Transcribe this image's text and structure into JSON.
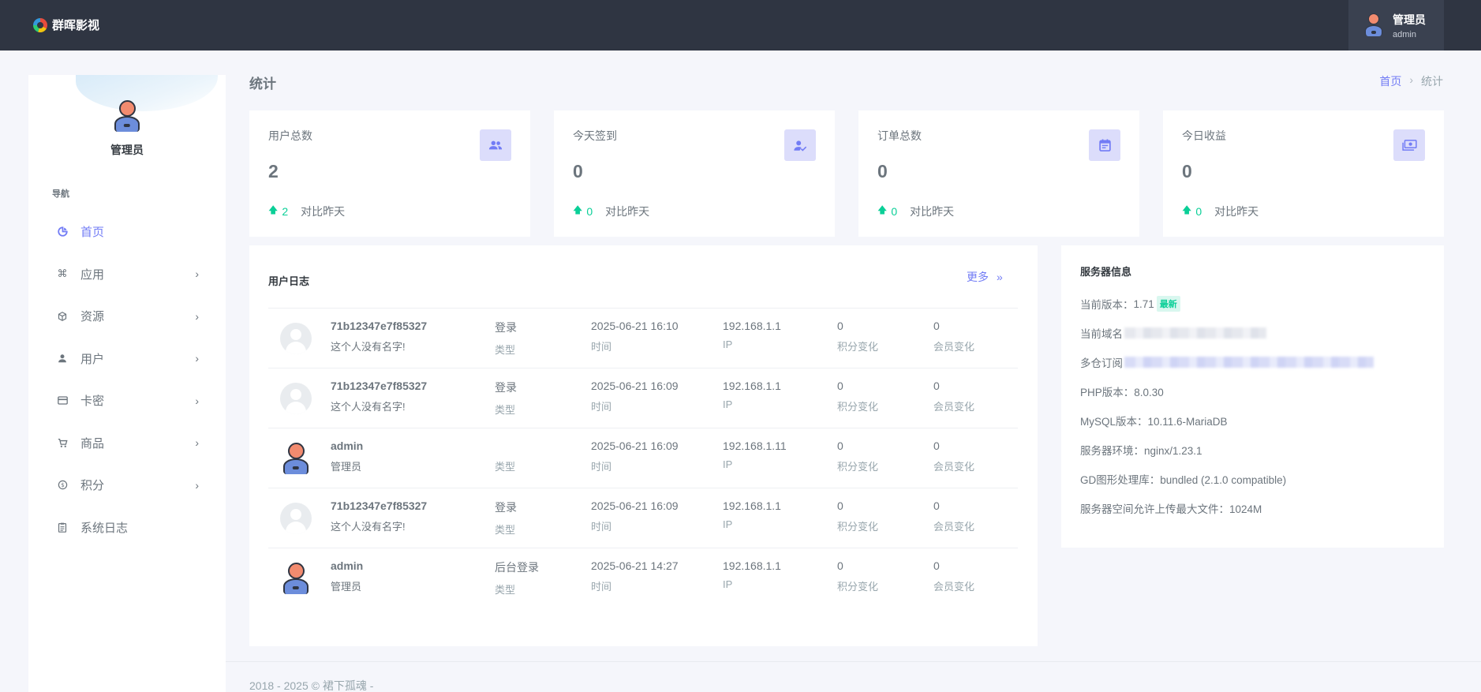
{
  "header": {
    "brand": "群晖影视",
    "user_name": "管理员",
    "user_role": "admin"
  },
  "sidebar": {
    "profile_name": "管理员",
    "nav_label": "导航",
    "items": [
      {
        "label": "首页",
        "icon": "dashboard-icon",
        "active": true
      },
      {
        "label": "应用",
        "icon": "command-icon",
        "has_children": true
      },
      {
        "label": "资源",
        "icon": "cube-icon",
        "has_children": true
      },
      {
        "label": "用户",
        "icon": "user-icon",
        "has_children": true
      },
      {
        "label": "卡密",
        "icon": "card-icon",
        "has_children": true
      },
      {
        "label": "商品",
        "icon": "cart-icon",
        "has_children": true
      },
      {
        "label": "积分",
        "icon": "coin-icon",
        "has_children": true
      },
      {
        "label": "系统日志",
        "icon": "log-icon"
      }
    ]
  },
  "page": {
    "title": "统计",
    "breadcrumb": [
      "首页",
      "统计"
    ]
  },
  "stats": [
    {
      "title": "用户总数",
      "value": "2",
      "delta": "2",
      "compare": "对比昨天",
      "icon": "users-icon"
    },
    {
      "title": "今天签到",
      "value": "0",
      "delta": "0",
      "compare": "对比昨天",
      "icon": "user-check-icon"
    },
    {
      "title": "订单总数",
      "value": "0",
      "delta": "0",
      "compare": "对比昨天",
      "icon": "calendar-icon"
    },
    {
      "title": "今日收益",
      "value": "0",
      "delta": "0",
      "compare": "对比昨天",
      "icon": "cash-icon"
    }
  ],
  "user_log": {
    "title": "用户日志",
    "more": "更多",
    "more_arrow": "»",
    "rows": [
      {
        "avatar": "placeholder",
        "user": "71b12347e7f85327",
        "desc": "这个人没有名字!",
        "type": "登录",
        "type_label": "类型",
        "time": "2025-06-21 16:10",
        "time_label": "时间",
        "ip": "192.168.1.1",
        "ip_label": "IP",
        "points": "0",
        "points_label": "积分变化",
        "member": "0",
        "member_label": "会员变化"
      },
      {
        "avatar": "placeholder",
        "user": "71b12347e7f85327",
        "desc": "这个人没有名字!",
        "type": "登录",
        "type_label": "类型",
        "time": "2025-06-21 16:09",
        "time_label": "时间",
        "ip": "192.168.1.1",
        "ip_label": "IP",
        "points": "0",
        "points_label": "积分变化",
        "member": "0",
        "member_label": "会员变化"
      },
      {
        "avatar": "admin",
        "user": "admin",
        "desc": "管理员",
        "type": "",
        "type_label": "类型",
        "time": "2025-06-21 16:09",
        "time_label": "时间",
        "ip": "192.168.1.11",
        "ip_label": "IP",
        "points": "0",
        "points_label": "积分变化",
        "member": "0",
        "member_label": "会员变化"
      },
      {
        "avatar": "placeholder",
        "user": "71b12347e7f85327",
        "desc": "这个人没有名字!",
        "type": "登录",
        "type_label": "类型",
        "time": "2025-06-21 16:09",
        "time_label": "时间",
        "ip": "192.168.1.1",
        "ip_label": "IP",
        "points": "0",
        "points_label": "积分变化",
        "member": "0",
        "member_label": "会员变化"
      },
      {
        "avatar": "admin",
        "user": "admin",
        "desc": "管理员",
        "type": "后台登录",
        "type_label": "类型",
        "time": "2025-06-21 14:27",
        "time_label": "时间",
        "ip": "192.168.1.1",
        "ip_label": "IP",
        "points": "0",
        "points_label": "积分变化",
        "member": "0",
        "member_label": "会员变化"
      }
    ]
  },
  "server": {
    "title": "服务器信息",
    "version_label": "当前版本：",
    "version": "1.71",
    "version_badge": "最新",
    "domain_label": "当前域名",
    "repo_label": "多仓订阅",
    "php": "PHP版本：8.0.30",
    "mysql": "MySQL版本：10.11.6-MariaDB",
    "env": "服务器环境：nginx/1.23.1",
    "gd": "GD图形处理库：bundled (2.1.0 compatible)",
    "upload": "服务器空间允许上传最大文件：1024M"
  },
  "footer": {
    "text": "2018 - 2025 © 裙下孤魂 -"
  },
  "colors": {
    "topbar": "#2f3542",
    "accent": "#727cf5",
    "success": "#0acf97",
    "icon_bg": "#dcddfb"
  }
}
